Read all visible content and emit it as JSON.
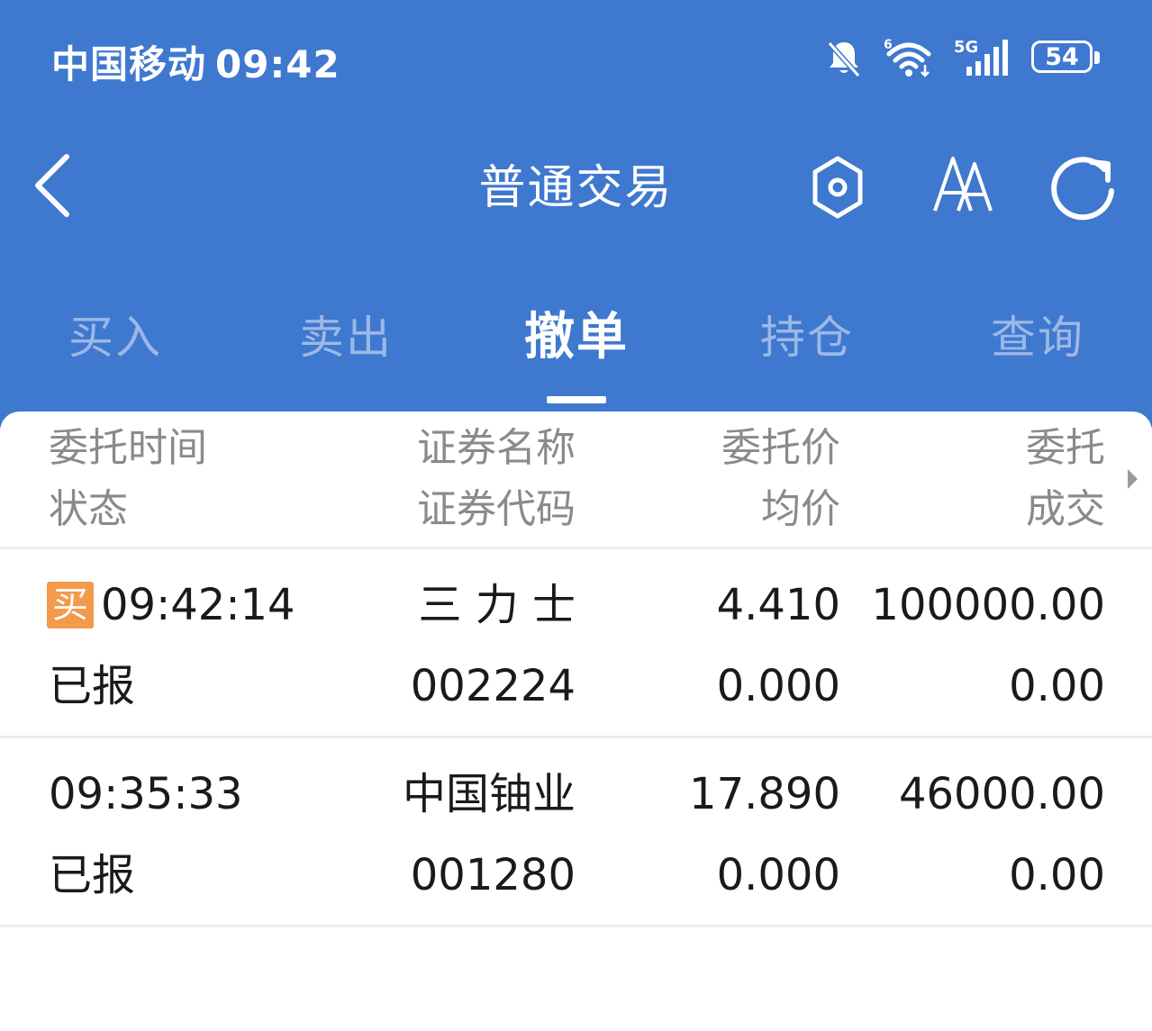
{
  "status_bar": {
    "carrier": "中国移动",
    "time": "09:42",
    "wifi_badge": "6",
    "signal_type": "5G",
    "battery_level": "54",
    "icons": [
      "bell-muted-icon",
      "wifi-icon",
      "cellular-signal-icon",
      "battery-icon"
    ]
  },
  "header": {
    "title": "普通交易",
    "icons": [
      "back-chevron-icon",
      "hexagon-settings-icon",
      "font-size-icon",
      "refresh-icon"
    ],
    "color": "#3f78cf"
  },
  "tabs": [
    {
      "label": "买入",
      "active": false
    },
    {
      "label": "卖出",
      "active": false
    },
    {
      "label": "撤单",
      "active": true
    },
    {
      "label": "持仓",
      "active": false
    },
    {
      "label": "查询",
      "active": false
    }
  ],
  "table": {
    "columns": [
      {
        "line1": "委托时间",
        "line2": "状态"
      },
      {
        "line1": "证券名称",
        "line2": "证券代码"
      },
      {
        "line1": "委托价",
        "line2": "均价"
      },
      {
        "line1": "委托",
        "line2": "成交"
      }
    ],
    "rows": [
      {
        "badge": "买",
        "time": "09:42:14",
        "status": "已报",
        "name": "三 力 士",
        "code": "002224",
        "price": "4.410",
        "avg_price": "0.000",
        "order_qty": "100000.00",
        "filled_qty": "0.00"
      },
      {
        "badge": "",
        "time": "09:35:33",
        "status": "已报",
        "name": "中国铀业",
        "code": "001280",
        "price": "17.890",
        "avg_price": "0.000",
        "order_qty": "46000.00",
        "filled_qty": "0.00"
      }
    ]
  },
  "colors": {
    "buy_badge": "#f39a4b",
    "inactive_tab": "#9db8e6",
    "header_text_muted": "#8a8a8a"
  }
}
